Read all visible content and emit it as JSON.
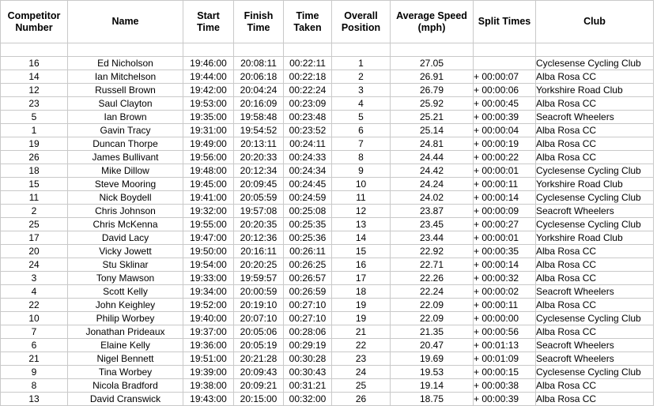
{
  "table": {
    "headers": [
      "Competitor Number",
      "Name",
      "Start Time",
      "Finish Time",
      "Time Taken",
      "Overall Position",
      "Average Speed (mph)",
      "Split Times",
      "Club"
    ],
    "header_lines": [
      [
        "Competitor",
        "Number"
      ],
      [
        "Name"
      ],
      [
        "Start",
        "Time"
      ],
      [
        "Finish",
        "Time"
      ],
      [
        "Time",
        "Taken"
      ],
      [
        "Overall",
        "Position"
      ],
      [
        "Average Speed",
        "(mph)"
      ],
      [
        "Split Times"
      ],
      [
        "Club"
      ]
    ],
    "rows": [
      [
        "16",
        "Ed Nicholson",
        "19:46:00",
        "20:08:11",
        "00:22:11",
        "1",
        "27.05",
        "",
        "Cyclesense Cycling Club"
      ],
      [
        "14",
        "Ian Mitchelson",
        "19:44:00",
        "20:06:18",
        "00:22:18",
        "2",
        "26.91",
        "+ 00:00:07",
        "Alba Rosa CC"
      ],
      [
        "12",
        "Russell Brown",
        "19:42:00",
        "20:04:24",
        "00:22:24",
        "3",
        "26.79",
        "+ 00:00:06",
        "Yorkshire Road Club"
      ],
      [
        "23",
        "Saul Clayton",
        "19:53:00",
        "20:16:09",
        "00:23:09",
        "4",
        "25.92",
        "+ 00:00:45",
        "Alba Rosa CC"
      ],
      [
        "5",
        "Ian Brown",
        "19:35:00",
        "19:58:48",
        "00:23:48",
        "5",
        "25.21",
        "+ 00:00:39",
        "Seacroft Wheelers"
      ],
      [
        "1",
        "Gavin Tracy",
        "19:31:00",
        "19:54:52",
        "00:23:52",
        "6",
        "25.14",
        "+ 00:00:04",
        "Alba Rosa CC"
      ],
      [
        "19",
        "Duncan Thorpe",
        "19:49:00",
        "20:13:11",
        "00:24:11",
        "7",
        "24.81",
        "+ 00:00:19",
        "Alba Rosa CC"
      ],
      [
        "26",
        "James Bullivant",
        "19:56:00",
        "20:20:33",
        "00:24:33",
        "8",
        "24.44",
        "+ 00:00:22",
        "Alba Rosa CC"
      ],
      [
        "18",
        "Mike Dillow",
        "19:48:00",
        "20:12:34",
        "00:24:34",
        "9",
        "24.42",
        "+ 00:00:01",
        "Cyclesense Cycling Club"
      ],
      [
        "15",
        "Steve Mooring",
        "19:45:00",
        "20:09:45",
        "00:24:45",
        "10",
        "24.24",
        "+ 00:00:11",
        "Yorkshire Road Club"
      ],
      [
        "11",
        "Nick Boydell",
        "19:41:00",
        "20:05:59",
        "00:24:59",
        "11",
        "24.02",
        "+ 00:00:14",
        "Cyclesense Cycling Club"
      ],
      [
        "2",
        "Chris Johnson",
        "19:32:00",
        "19:57:08",
        "00:25:08",
        "12",
        "23.87",
        "+ 00:00:09",
        "Seacroft Wheelers"
      ],
      [
        "25",
        "Chris McKenna",
        "19:55:00",
        "20:20:35",
        "00:25:35",
        "13",
        "23.45",
        "+ 00:00:27",
        "Cyclesense Cycling Club"
      ],
      [
        "17",
        "David Lacy",
        "19:47:00",
        "20:12:36",
        "00:25:36",
        "14",
        "23.44",
        "+ 00:00:01",
        "Yorkshire Road Club"
      ],
      [
        "20",
        "Vicky Jowett",
        "19:50:00",
        "20:16:11",
        "00:26:11",
        "15",
        "22.92",
        "+ 00:00:35",
        "Alba Rosa CC"
      ],
      [
        "24",
        "Stu Sklinar",
        "19:54:00",
        "20:20:25",
        "00:26:25",
        "16",
        "22.71",
        "+ 00:00:14",
        "Alba Rosa CC"
      ],
      [
        "3",
        "Tony Mawson",
        "19:33:00",
        "19:59:57",
        "00:26:57",
        "17",
        "22.26",
        "+ 00:00:32",
        "Alba Rosa CC"
      ],
      [
        "4",
        "Scott Kelly",
        "19:34:00",
        "20:00:59",
        "00:26:59",
        "18",
        "22.24",
        "+ 00:00:02",
        "Seacroft Wheelers"
      ],
      [
        "22",
        "John Keighley",
        "19:52:00",
        "20:19:10",
        "00:27:10",
        "19",
        "22.09",
        "+ 00:00:11",
        "Alba Rosa CC"
      ],
      [
        "10",
        "Philip Worbey",
        "19:40:00",
        "20:07:10",
        "00:27:10",
        "19",
        "22.09",
        "+ 00:00:00",
        "Cyclesense Cycling Club"
      ],
      [
        "7",
        "Jonathan Prideaux",
        "19:37:00",
        "20:05:06",
        "00:28:06",
        "21",
        "21.35",
        "+ 00:00:56",
        "Alba Rosa CC"
      ],
      [
        "6",
        "Elaine Kelly",
        "19:36:00",
        "20:05:19",
        "00:29:19",
        "22",
        "20.47",
        "+ 00:01:13",
        "Seacroft Wheelers"
      ],
      [
        "21",
        "Nigel Bennett",
        "19:51:00",
        "20:21:28",
        "00:30:28",
        "23",
        "19.69",
        "+ 00:01:09",
        "Seacroft Wheelers"
      ],
      [
        "9",
        "Tina Worbey",
        "19:39:00",
        "20:09:43",
        "00:30:43",
        "24",
        "19.53",
        "+ 00:00:15",
        "Cyclesense Cycling Club"
      ],
      [
        "8",
        "Nicola Bradford",
        "19:38:00",
        "20:09:21",
        "00:31:21",
        "25",
        "19.14",
        "+ 00:00:38",
        "Alba Rosa CC"
      ],
      [
        "13",
        "David Cranswick",
        "19:43:00",
        "20:15:00",
        "00:32:00",
        "26",
        "18.75",
        "+ 00:00:39",
        "Alba Rosa CC"
      ]
    ]
  },
  "colors": {
    "border": "#c9c9c9",
    "text": "#000000",
    "background": "#ffffff"
  }
}
